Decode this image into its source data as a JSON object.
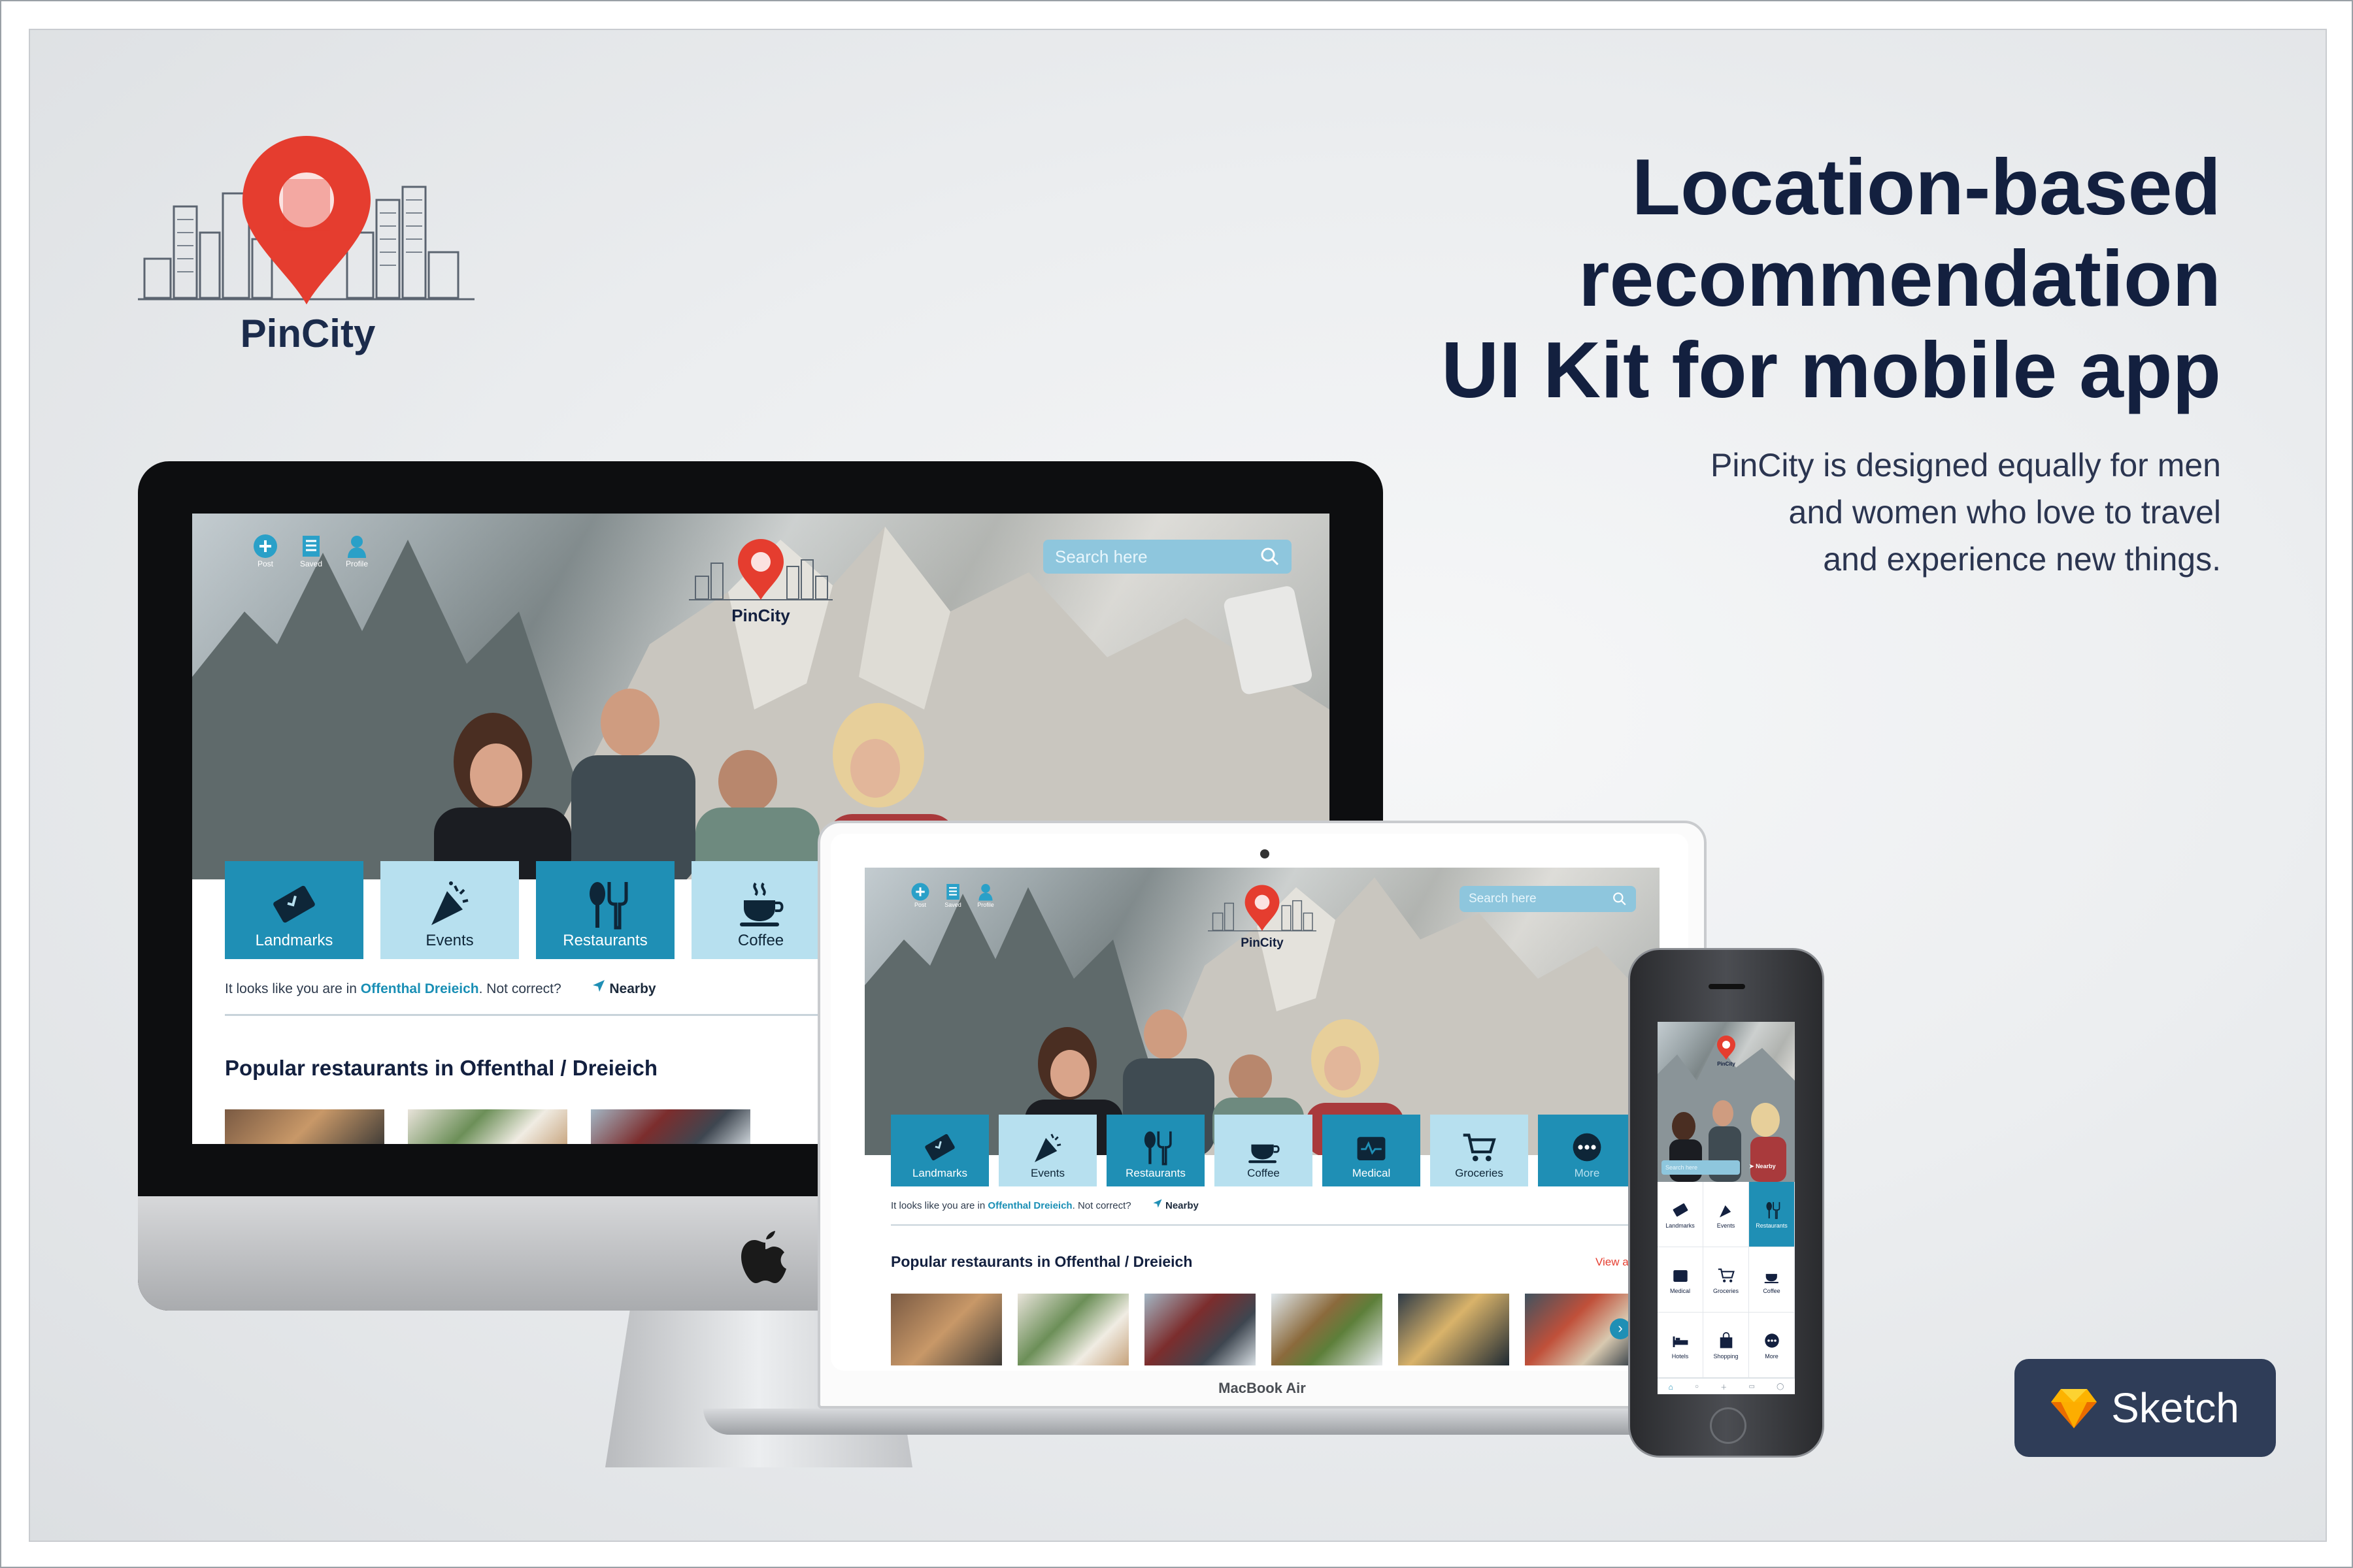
{
  "brand": {
    "name": "PinCity",
    "accent": "#e53d2f",
    "navy": "#13203f",
    "teal": "#1f8fb5",
    "light_teal": "#b7e0ef"
  },
  "headline": [
    "Location-based",
    "recommendation",
    "UI Kit for mobile app"
  ],
  "subline": [
    "PinCity is designed equally for men",
    "and women who love to travel",
    "and experience new things."
  ],
  "badge": {
    "label": "Sketch",
    "icon": "sketch-diamond-icon"
  },
  "imac": {
    "nav": [
      {
        "label": "Post",
        "icon": "plus-circle-icon"
      },
      {
        "label": "Saved",
        "icon": "saved-list-icon"
      },
      {
        "label": "Profile",
        "icon": "profile-icon"
      }
    ],
    "logo_text": "PinCity",
    "search_placeholder": "Search here",
    "categories": [
      {
        "label": "Landmarks",
        "icon": "ticket-icon",
        "style": "dark"
      },
      {
        "label": "Events",
        "icon": "party-popper-icon",
        "style": "light"
      },
      {
        "label": "Restaurants",
        "icon": "cutlery-icon",
        "style": "dark"
      },
      {
        "label": "Coffee",
        "icon": "coffee-cup-icon",
        "style": "light"
      }
    ],
    "location": {
      "prefix": "It looks like you are in ",
      "place": "Offenthal Dreieich",
      "suffix": ". Not correct?",
      "nearby": "Nearby"
    },
    "section_title": "Popular restaurants in Offenthal / Dreieich"
  },
  "macbook": {
    "nav": [
      {
        "label": "Post",
        "icon": "plus-circle-icon"
      },
      {
        "label": "Saved",
        "icon": "saved-list-icon"
      },
      {
        "label": "Profile",
        "icon": "profile-icon"
      }
    ],
    "logo_text": "PinCity",
    "search_placeholder": "Search here",
    "categories": [
      {
        "label": "Landmarks",
        "icon": "ticket-icon",
        "style": "dark"
      },
      {
        "label": "Events",
        "icon": "party-popper-icon",
        "style": "light"
      },
      {
        "label": "Restaurants",
        "icon": "cutlery-icon",
        "style": "dark"
      },
      {
        "label": "Coffee",
        "icon": "coffee-cup-icon",
        "style": "light"
      },
      {
        "label": "Medical",
        "icon": "medical-kit-icon",
        "style": "dark"
      },
      {
        "label": "Groceries",
        "icon": "cart-icon",
        "style": "light"
      },
      {
        "label": "More",
        "icon": "more-dots-icon",
        "style": "dark"
      }
    ],
    "location": {
      "prefix": "It looks like you are in ",
      "place": "Offenthal Dreieich",
      "suffix": ". Not correct?",
      "nearby": "Nearby"
    },
    "section_title": "Popular restaurants in Offenthal / Dreieich",
    "view_all": "View a",
    "label": "MacBook Air"
  },
  "phone": {
    "logo_text": "PinCity",
    "search_placeholder": "Search here",
    "nearby": "Nearby",
    "grid": [
      {
        "label": "Landmarks",
        "icon": "ticket-icon"
      },
      {
        "label": "Events",
        "icon": "party-popper-icon"
      },
      {
        "label": "Restaurants",
        "icon": "cutlery-icon",
        "active": true
      },
      {
        "label": "Medical",
        "icon": "medical-kit-icon"
      },
      {
        "label": "Groceries",
        "icon": "cart-icon"
      },
      {
        "label": "Coffee",
        "icon": "coffee-cup-icon"
      },
      {
        "label": "Hotels",
        "icon": "bed-icon"
      },
      {
        "label": "Shopping",
        "icon": "shopping-bag-icon"
      },
      {
        "label": "More",
        "icon": "more-dots-icon"
      }
    ]
  }
}
